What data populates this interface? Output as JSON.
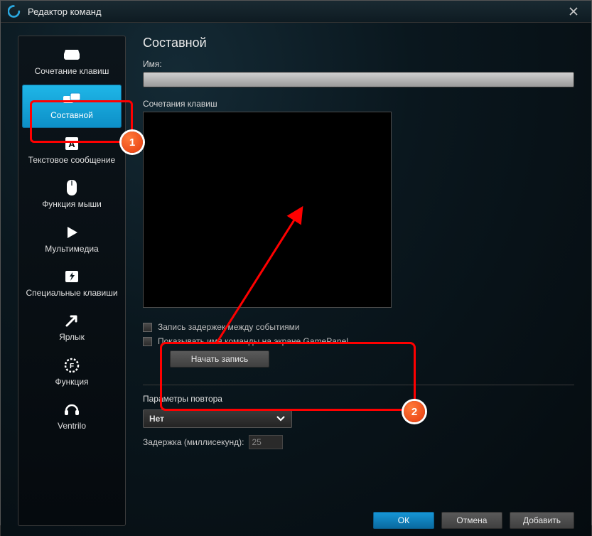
{
  "window": {
    "title": "Редактор команд"
  },
  "sidebar": {
    "items": [
      {
        "label": "Сочетание клавиш"
      },
      {
        "label": "Составной"
      },
      {
        "label": "Текстовое сообщение"
      },
      {
        "label": "Функция мыши"
      },
      {
        "label": "Мультимедиа"
      },
      {
        "label": "Специальные клавиши"
      },
      {
        "label": "Ярлык"
      },
      {
        "label": "Функция"
      },
      {
        "label": "Ventrilo"
      }
    ]
  },
  "main": {
    "heading": "Составной",
    "name_label": "Имя:",
    "name_value": "",
    "keys_label": "Сочетания клавиш",
    "cb_record_delays": "Запись задержек между событиями",
    "cb_show_name": "Показывать имя команды на экране GamePanel",
    "start_record": "Начать запись",
    "repeat_title": "Параметры повтора",
    "repeat_value": "Нет",
    "delay_label": "Задержка (миллисекунд):",
    "delay_value": "25"
  },
  "footer": {
    "ok": "ОК",
    "cancel": "Отмена",
    "add": "Добавить"
  },
  "badges": {
    "one": "1",
    "two": "2"
  }
}
